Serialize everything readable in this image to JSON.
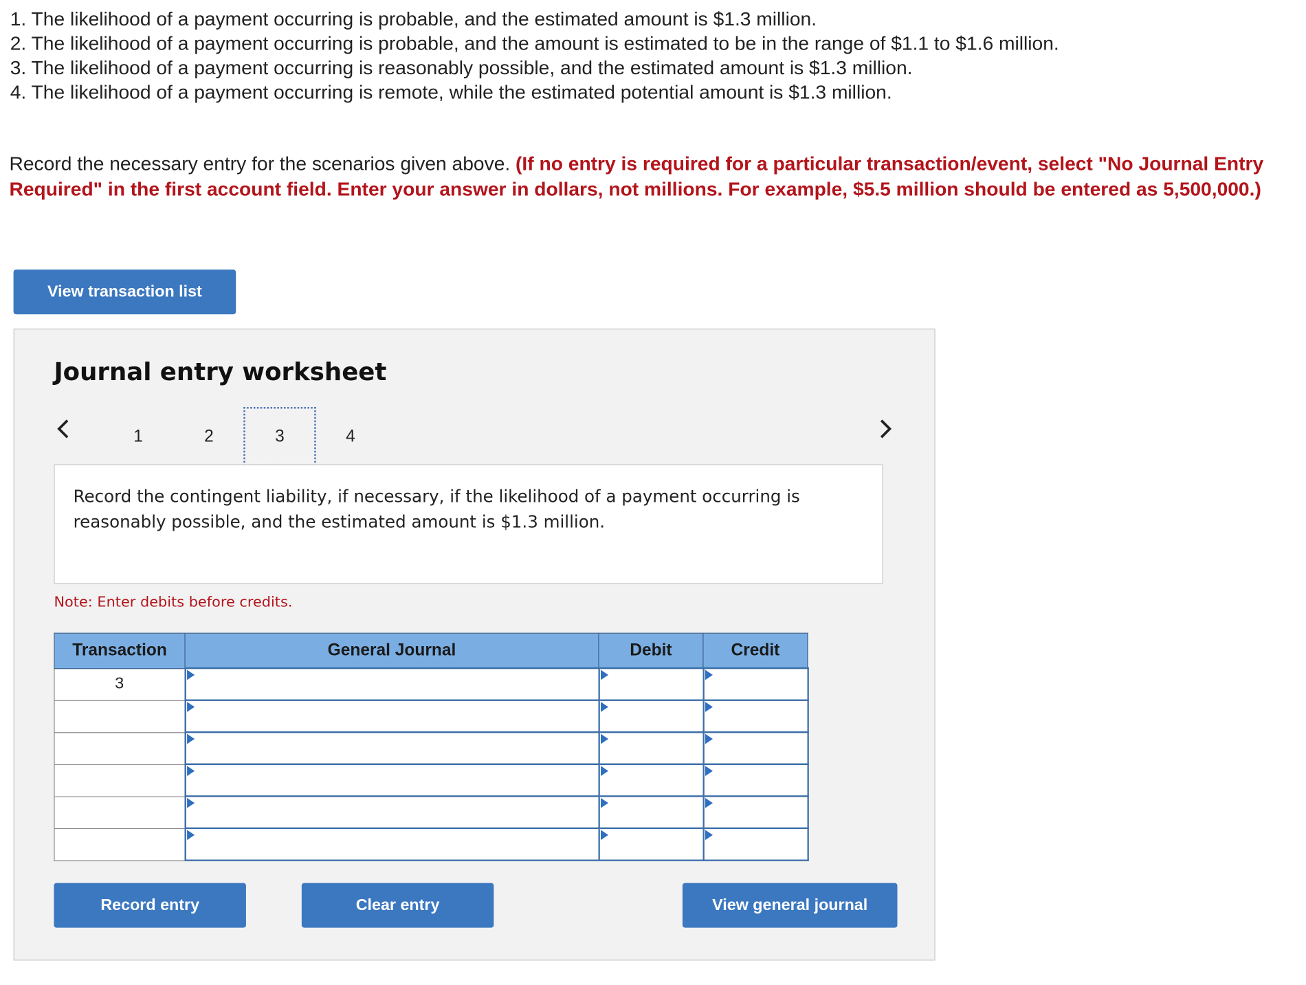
{
  "scenarios": [
    "1. The likelihood of a payment occurring is probable, and the estimated amount is $1.3 million.",
    "2. The likelihood of a payment occurring is probable, and the amount is estimated to be in the range of $1.1 to $1.6 million.",
    "3. The likelihood of a payment occurring is reasonably possible, and the estimated amount is $1.3 million.",
    "4. The likelihood of a payment occurring is remote, while the estimated potential amount is $1.3 million."
  ],
  "instructions": {
    "text": "Record the necessary entry for the scenarios given above. ",
    "requirement": "(If no entry is required for a particular transaction/event, select \"No Journal Entry Required\" in the first account field. Enter your answer in dollars, not millions. For example, $5.5 million should be entered as 5,500,000.)"
  },
  "buttons": {
    "view_transaction_list": "View transaction list",
    "record_entry": "Record entry",
    "clear_entry": "Clear entry",
    "view_general_journal": "View general journal"
  },
  "worksheet": {
    "title": "Journal entry worksheet",
    "pages": [
      "1",
      "2",
      "3",
      "4"
    ],
    "active_page": "3",
    "prompt": "Record the contingent liability, if necessary, if the likelihood of a payment occurring is reasonably possible, and the estimated amount is $1.3 million.",
    "note": "Note: Enter debits before credits."
  },
  "journal": {
    "headers": {
      "transaction": "Transaction",
      "general_journal": "General Journal",
      "debit": "Debit",
      "credit": "Credit"
    },
    "rows": [
      {
        "transaction": "3",
        "account": "",
        "debit": "",
        "credit": ""
      },
      {
        "transaction": "",
        "account": "",
        "debit": "",
        "credit": ""
      },
      {
        "transaction": "",
        "account": "",
        "debit": "",
        "credit": ""
      },
      {
        "transaction": "",
        "account": "",
        "debit": "",
        "credit": ""
      },
      {
        "transaction": "",
        "account": "",
        "debit": "",
        "credit": ""
      },
      {
        "transaction": "",
        "account": "",
        "debit": "",
        "credit": ""
      }
    ]
  },
  "icons": {
    "prev": "chevron-left-icon",
    "next": "chevron-right-icon",
    "dropdown_marker": "dropdown-triangle-icon"
  },
  "colors": {
    "button_blue": "#3b78c0",
    "header_blue": "#7aaee3",
    "required_red": "#b3141b"
  }
}
